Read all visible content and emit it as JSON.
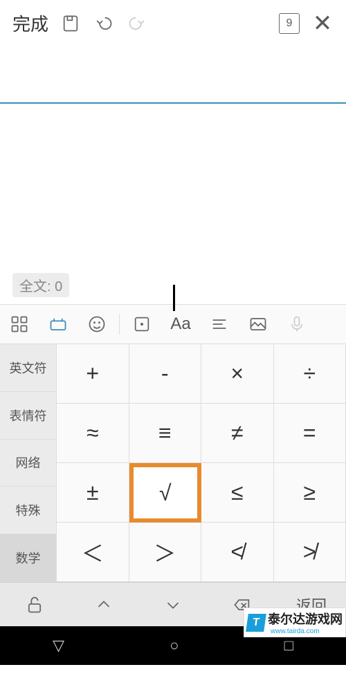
{
  "topbar": {
    "done": "完成",
    "box_number": "9"
  },
  "editor": {
    "badge": "全文: 0"
  },
  "categories": [
    {
      "label": "英文符",
      "active": false
    },
    {
      "label": "表情符",
      "active": false
    },
    {
      "label": "网络",
      "active": false
    },
    {
      "label": "特殊",
      "active": false
    },
    {
      "label": "数学",
      "active": true
    }
  ],
  "keys": [
    [
      "+",
      "-",
      "×",
      "÷"
    ],
    [
      "≈",
      "≡",
      "≠",
      "="
    ],
    [
      "±",
      "√",
      "≤",
      "≥"
    ],
    [
      "＜",
      "＞",
      "≮",
      "≯"
    ]
  ],
  "highlighted_key": "√",
  "bottom": {
    "back": "返回"
  },
  "toolbar_text": "Aa",
  "watermark": {
    "logo": "T",
    "text": "泰尔达游戏网",
    "url": "www.tairda.com"
  }
}
